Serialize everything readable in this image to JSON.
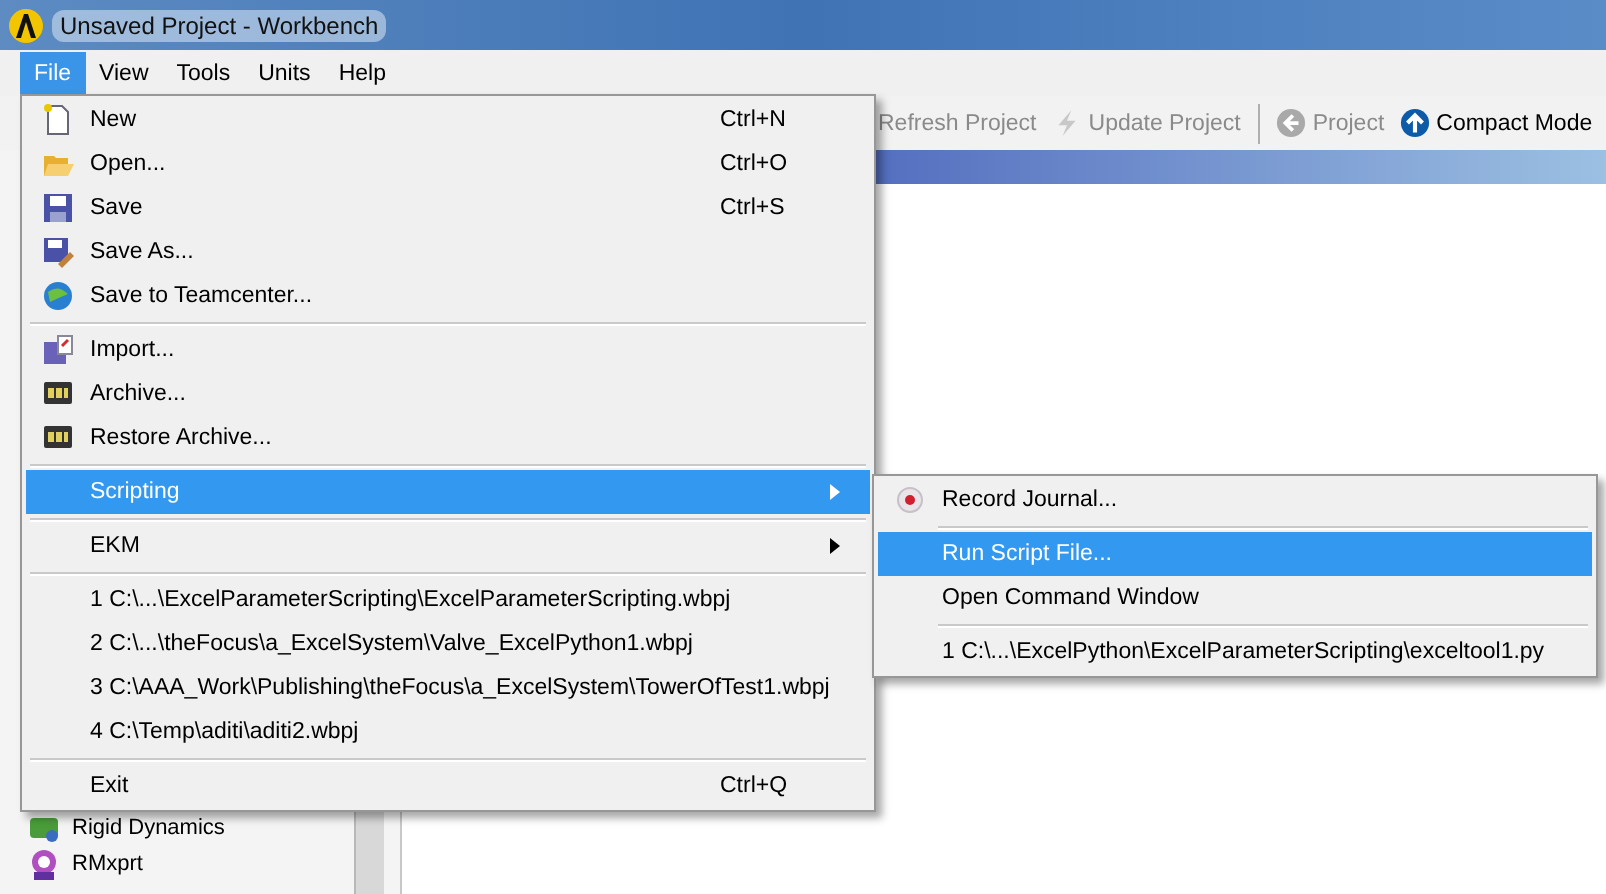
{
  "window": {
    "title": "Unsaved Project - Workbench"
  },
  "menubar": [
    {
      "label": "File",
      "selected": true
    },
    {
      "label": "View",
      "selected": false
    },
    {
      "label": "Tools",
      "selected": false
    },
    {
      "label": "Units",
      "selected": false
    },
    {
      "label": "Help",
      "selected": false
    }
  ],
  "toolbar": [
    {
      "label": "Refresh Project",
      "disabled": true
    },
    {
      "label": "Update Project",
      "disabled": true
    },
    {
      "label": "Project",
      "disabled": true
    },
    {
      "label": "Compact Mode",
      "disabled": false
    }
  ],
  "toolbox": [
    "Rigid Dynamics",
    "RMxprt"
  ],
  "file_menu": [
    {
      "kind": "item",
      "label": "New",
      "shortcut": "Ctrl+N",
      "selected": false
    },
    {
      "kind": "item",
      "label": "Open...",
      "shortcut": "Ctrl+O",
      "selected": false
    },
    {
      "kind": "item",
      "label": "Save",
      "shortcut": "Ctrl+S",
      "selected": false
    },
    {
      "kind": "item",
      "label": "Save As...",
      "selected": false
    },
    {
      "kind": "item",
      "label": "Save to Teamcenter...",
      "selected": false
    },
    {
      "kind": "separator"
    },
    {
      "kind": "item",
      "label": "Import...",
      "selected": false
    },
    {
      "kind": "item",
      "label": "Archive...",
      "selected": false
    },
    {
      "kind": "item",
      "label": "Restore Archive...",
      "selected": false
    },
    {
      "kind": "separator"
    },
    {
      "kind": "submenu",
      "label": "Scripting",
      "selected": true
    },
    {
      "kind": "separator"
    },
    {
      "kind": "submenu",
      "label": "EKM",
      "selected": false
    },
    {
      "kind": "separator"
    },
    {
      "kind": "item",
      "label": "1 C:\\...\\ExcelParameterScripting\\ExcelParameterScripting.wbpj",
      "selected": false
    },
    {
      "kind": "item",
      "label": "2 C:\\...\\theFocus\\a_ExcelSystem\\Valve_ExcelPython1.wbpj",
      "selected": false
    },
    {
      "kind": "item",
      "label": "3 C:\\AAA_Work\\Publishing\\theFocus\\a_ExcelSystem\\TowerOfTest1.wbpj",
      "selected": false
    },
    {
      "kind": "item",
      "label": "4 C:\\Temp\\aditi\\aditi2.wbpj",
      "selected": false
    },
    {
      "kind": "separator"
    },
    {
      "kind": "item",
      "label": "Exit",
      "shortcut": "Ctrl+Q",
      "selected": false
    }
  ],
  "scripting_menu": [
    {
      "kind": "item",
      "label": "Record Journal...",
      "selected": false
    },
    {
      "kind": "separator"
    },
    {
      "kind": "item",
      "label": "Run Script File...",
      "selected": true
    },
    {
      "kind": "item",
      "label": "Open Command Window",
      "selected": false
    },
    {
      "kind": "separator"
    },
    {
      "kind": "item",
      "label": "1 C:\\...\\ExcelPython\\ExcelParameterScripting\\exceltool1.py",
      "selected": false
    }
  ]
}
